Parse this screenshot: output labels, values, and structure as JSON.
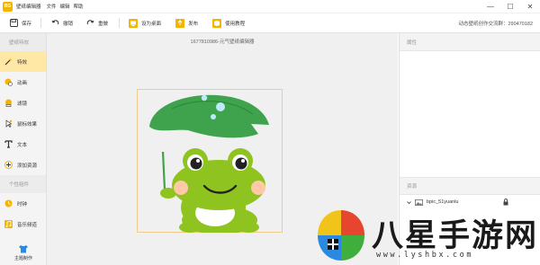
{
  "app": {
    "logo_text": "BG",
    "title": "壁纸编辑器",
    "menu": [
      "文件",
      "编辑",
      "帮助"
    ],
    "window_controls": {
      "minimize": "—",
      "maximize": "☐",
      "close": "✕"
    }
  },
  "toolbar": {
    "save": "保存",
    "undo": "撤销",
    "redo": "重做",
    "set_desktop": "设为桌面",
    "publish": "发布",
    "tutorial": "使用教程",
    "contact": "动态壁纸创作交流群：290470182"
  },
  "sidebar": {
    "section1": "壁纸特效",
    "items": [
      {
        "label": "特效",
        "icon": "magic-wand-icon"
      },
      {
        "label": "动画",
        "icon": "animation-icon"
      },
      {
        "label": "滤镜",
        "icon": "filter-icon"
      },
      {
        "label": "鼠标效果",
        "icon": "cursor-icon"
      },
      {
        "label": "文本",
        "icon": "text-icon"
      },
      {
        "label": "添加资源",
        "icon": "add-resource-icon"
      }
    ],
    "section2": "个性组件",
    "items2": [
      {
        "label": "时钟",
        "icon": "clock-icon"
      },
      {
        "label": "音乐频道",
        "icon": "music-icon"
      }
    ],
    "bottom": {
      "label": "主题制作",
      "icon": "theme-icon"
    }
  },
  "canvas": {
    "title": "1677810986-元气壁纸编辑器"
  },
  "right_panel": {
    "properties_title": "属性",
    "resources_title": "资源",
    "resources": [
      {
        "name": "bpic_51yuanlu",
        "locked": true
      }
    ]
  },
  "watermark": {
    "text": "八星手游网",
    "url": "www.lyshbx.com"
  },
  "colors": {
    "accent": "#f5b400",
    "active_item": "#ffe8a6",
    "frog_green": "#8fc31f",
    "leaf_green": "#3fa34d"
  }
}
